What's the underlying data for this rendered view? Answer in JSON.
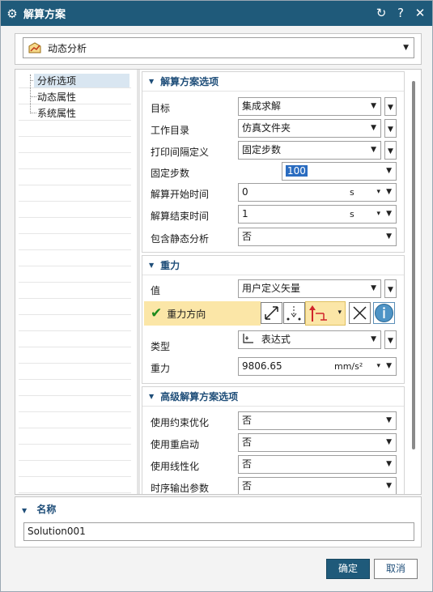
{
  "window": {
    "title": "解算方案",
    "icon": "gear-icon",
    "controls": {
      "reset": "↻",
      "help": "?",
      "close": "✕"
    }
  },
  "solution_type": {
    "icon": "dynamic-analysis-icon",
    "value": "动态分析"
  },
  "tree": {
    "items": [
      {
        "label": "分析选项",
        "selected": true
      },
      {
        "label": "动态属性",
        "selected": false
      },
      {
        "label": "系统属性",
        "selected": false
      }
    ]
  },
  "section_solution": {
    "title": "解算方案选项",
    "target_label": "目标",
    "target_value": "集成求解",
    "workdir_label": "工作目录",
    "workdir_value": "仿真文件夹",
    "print_label": "打印间隔定义",
    "print_value": "固定步数",
    "steps_label": "固定步数",
    "steps_value": "100",
    "start_label": "解算开始时间",
    "start_value": "0",
    "start_unit": "s",
    "end_label": "解算结束时间",
    "end_value": "1",
    "end_unit": "s",
    "static_label": "包含静态分析",
    "static_value": "否"
  },
  "section_gravity": {
    "title": "重力",
    "value_label": "值",
    "value_value": "用户定义矢量",
    "direction_label": "重力方向",
    "type_label": "类型",
    "type_value": "表达式",
    "gravity_label": "重力",
    "gravity_value": "9806.65",
    "gravity_unit": "mm/s²"
  },
  "section_advanced": {
    "title": "高级解算方案选项",
    "constraint_label": "使用约束优化",
    "constraint_value": "否",
    "restart_label": "使用重启动",
    "restart_value": "否",
    "linear_label": "使用线性化",
    "linear_value": "否",
    "output_label": "时序输出参数",
    "output_value": "否"
  },
  "name_section": {
    "title": "名称",
    "value": "Solution001"
  },
  "buttons": {
    "ok": "确定",
    "cancel": "取消"
  },
  "colors": {
    "titlebar": "#1f5a7a",
    "section_title": "#1f4e79",
    "highlight": "#fbe6a7",
    "check": "#1c8a1c",
    "vector_red": "#d0242b"
  }
}
